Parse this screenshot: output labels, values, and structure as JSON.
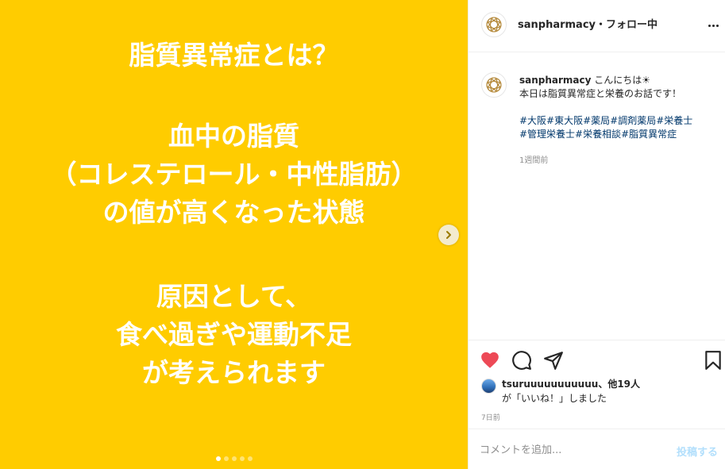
{
  "slide": {
    "heading": "脂質異常症とは？",
    "definition_lines": [
      "血中の脂質",
      "（コレステロール・中性脂肪）",
      "の値が高くなった状態"
    ],
    "cause_lines": [
      "原因として、",
      "食べ過ぎや運動不足",
      "が考えられます"
    ],
    "dot_count": 5,
    "active_dot": 0,
    "background_color": "#ffcc00"
  },
  "header": {
    "username": "sanpharmacy",
    "follow_status": "・フォロー中",
    "more_icon": "ellipsis-icon"
  },
  "caption": {
    "username": "sanpharmacy",
    "text_line1": "こんにちは☀",
    "text_line2": "本日は脂質異常症と栄養のお話です！",
    "hashtags_line1": "#大阪#東大阪#薬局#調剤薬局#栄養士",
    "hashtags_line2": "#管理栄養士#栄養相談#脂質異常症",
    "time": "1週間前"
  },
  "actions": {
    "like_icon": "heart-icon",
    "comment_icon": "comment-icon",
    "share_icon": "share-icon",
    "save_icon": "bookmark-icon",
    "liked_color": "#ed4956"
  },
  "likes": {
    "line1": "tsuruuuuuuuuuuu、他19人",
    "line2": "が「いいね！」しました"
  },
  "post_date": "7日前",
  "comment": {
    "placeholder": "コメントを追加...",
    "post_label": "投稿する"
  }
}
